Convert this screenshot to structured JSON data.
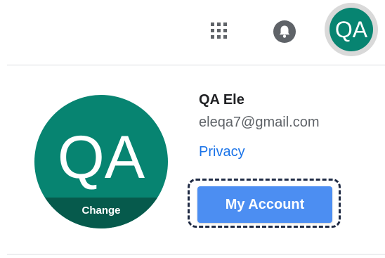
{
  "topbar": {
    "apps_icon": "apps-grid-icon",
    "notifications_icon": "bell-icon",
    "avatar_initials": "QA",
    "avatar_color": "#078471"
  },
  "profile": {
    "initials": "QA",
    "change_label": "Change",
    "name": "QA Ele",
    "email": "eleqa7@gmail.com",
    "privacy_link": "Privacy",
    "account_button": "My Account"
  },
  "colors": {
    "avatar_green": "#078471",
    "avatar_dark_band": "#065a4c",
    "link_blue": "#1a73e8",
    "button_blue": "#4c8ef2",
    "focus_ring": "#1f2a44"
  }
}
